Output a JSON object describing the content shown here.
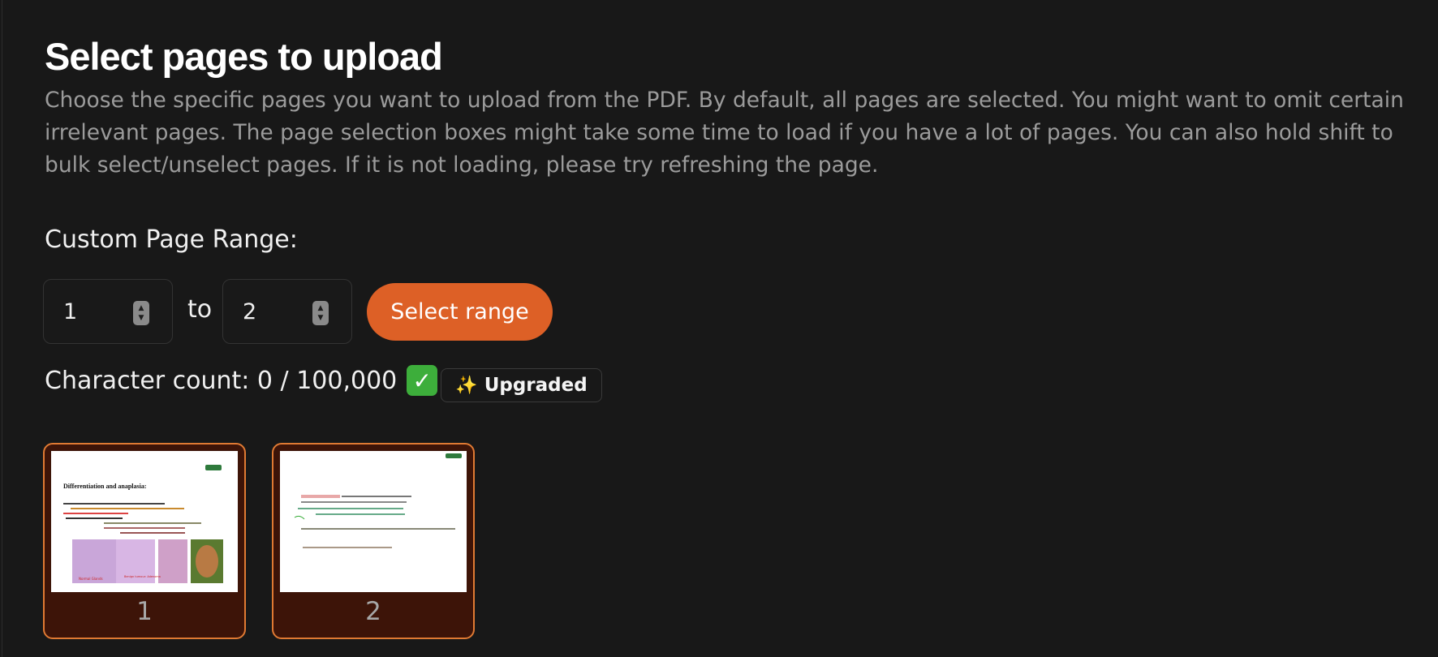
{
  "title": "Select pages to upload",
  "description": "Choose the specific pages you want to upload from the PDF. By default, all pages are selected. You might want to omit certain irrelevant pages. The page selection boxes might take some time to load if you have a lot of pages. You can also hold shift to bulk select/unselect pages. If it is not loading, please try refreshing the page.",
  "range": {
    "label": "Custom Page Range:",
    "from_value": "1",
    "to_label": "to",
    "to_value": "2",
    "button_label": "Select range"
  },
  "character_count": {
    "text": "Character count: 0 / 100,000",
    "check_icon": "check-mark-icon",
    "badge_icon": "sparkles-icon",
    "badge_label": "Upgraded"
  },
  "pages": [
    {
      "number": "1",
      "selected": true,
      "thumb_title": "Differentiation and anaplasia:",
      "thumb_labels": [
        "Normal Glands",
        "Benign tumour: Adenoma"
      ]
    },
    {
      "number": "2",
      "selected": true,
      "thumb_title": "",
      "thumb_labels": []
    }
  ],
  "colors": {
    "background": "#181818",
    "accent": "#dd6026",
    "selected_card_bg": "#3d1408",
    "selected_card_border": "#e07a33",
    "check_green": "#3dae3b"
  }
}
